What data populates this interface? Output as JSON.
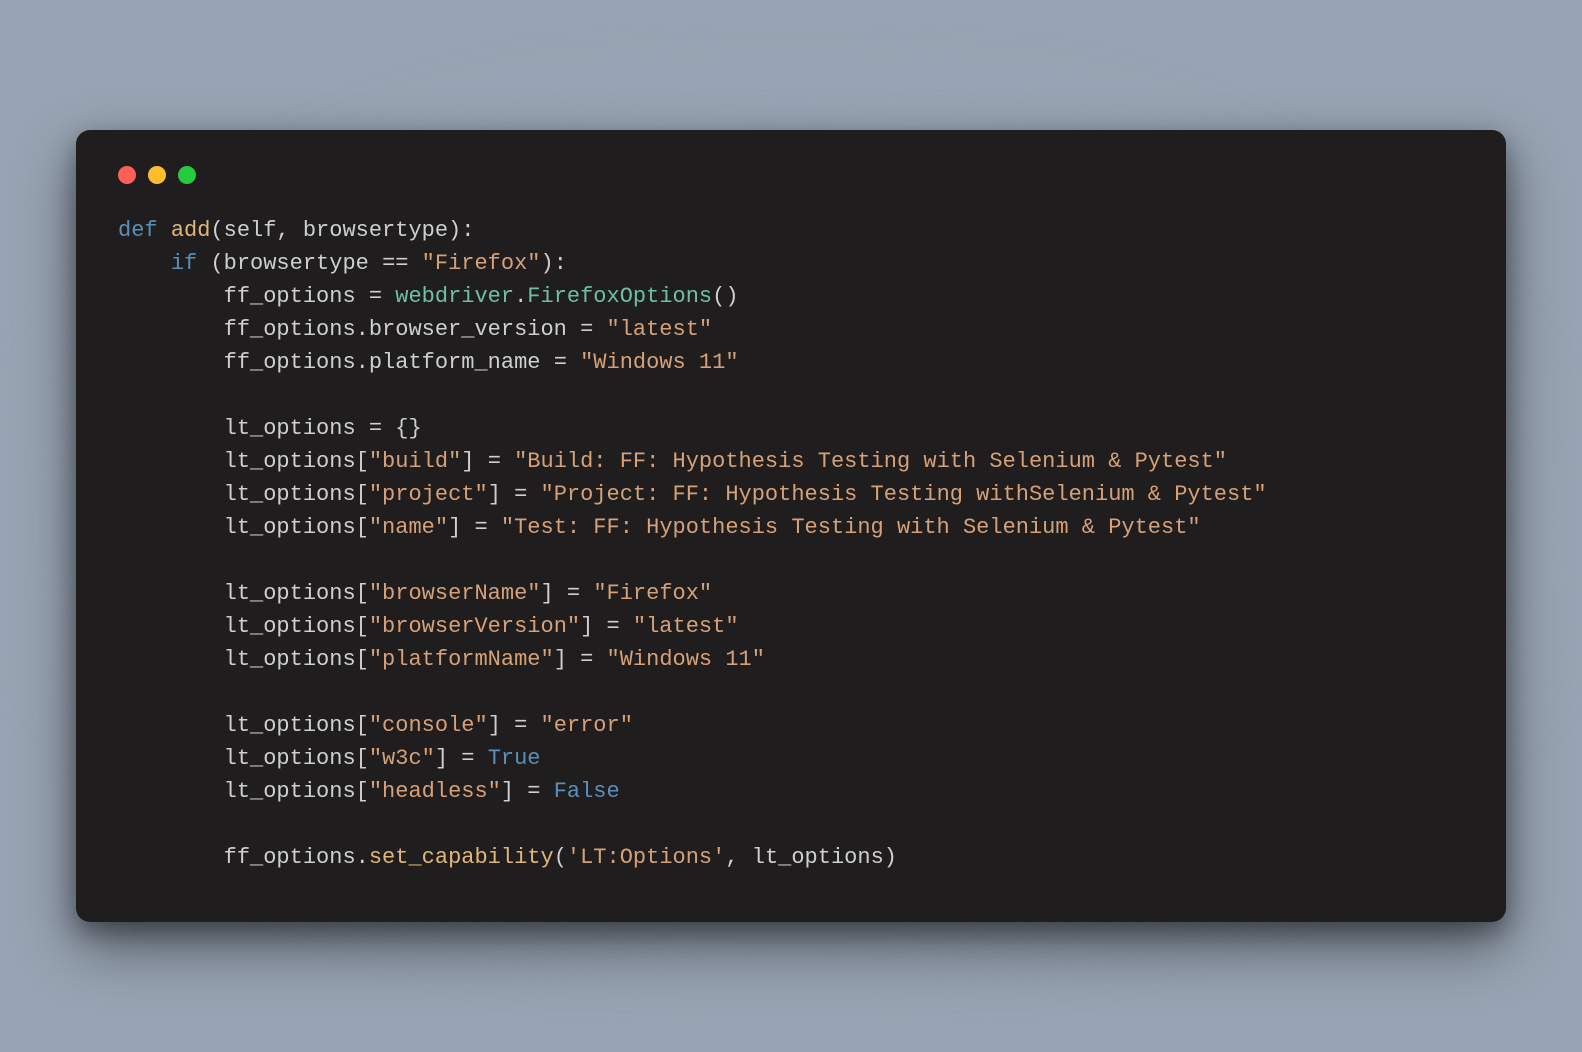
{
  "colors": {
    "traffic_red": "#ff5f56",
    "traffic_yellow": "#ffbd2e",
    "traffic_green": "#27c93f",
    "bg": "#1f1d1d"
  },
  "code": {
    "l1": {
      "kw": "def",
      "fn": "add",
      "p": "(self, browsertype):"
    },
    "l2": {
      "kw": "if",
      "p1": " (browsertype ",
      "op": "==",
      "sp": " ",
      "str": "\"Firefox\"",
      "p2": "):"
    },
    "l3": {
      "var": "ff_options",
      "op": " = ",
      "mod": "webdriver",
      "dot": ".",
      "cls": "FirefoxOptions",
      "p": "()"
    },
    "l4": {
      "pre": "ff_options.browser_version ",
      "op": "=",
      "sp": " ",
      "str": "\"latest\""
    },
    "l5": {
      "pre": "ff_options.platform_name ",
      "op": "=",
      "sp": " ",
      "str": "\"Windows 11\""
    },
    "l7": {
      "pre": "lt_options ",
      "op": "=",
      "p": " {}"
    },
    "l8": {
      "pre": "lt_options[",
      "k": "\"build\"",
      "mid": "] ",
      "op": "=",
      "sp": " ",
      "str": "\"Build: FF: Hypothesis Testing with Selenium & Pytest\""
    },
    "l9": {
      "pre": "lt_options[",
      "k": "\"project\"",
      "mid": "] ",
      "op": "=",
      "sp": " ",
      "str": "\"Project: FF: Hypothesis Testing withSelenium & Pytest\""
    },
    "l10": {
      "pre": "lt_options[",
      "k": "\"name\"",
      "mid": "] ",
      "op": "=",
      "sp": " ",
      "str": "\"Test: FF: Hypothesis Testing with Selenium & Pytest\""
    },
    "l12": {
      "pre": "lt_options[",
      "k": "\"browserName\"",
      "mid": "] ",
      "op": "=",
      "sp": " ",
      "str": "\"Firefox\""
    },
    "l13": {
      "pre": "lt_options[",
      "k": "\"browserVersion\"",
      "mid": "] ",
      "op": "=",
      "sp": " ",
      "str": "\"latest\""
    },
    "l14": {
      "pre": "lt_options[",
      "k": "\"platformName\"",
      "mid": "] ",
      "op": "=",
      "sp": " ",
      "str": "\"Windows 11\""
    },
    "l16": {
      "pre": "lt_options[",
      "k": "\"console\"",
      "mid": "] ",
      "op": "=",
      "sp": " ",
      "str": "\"error\""
    },
    "l17": {
      "pre": "lt_options[",
      "k": "\"w3c\"",
      "mid": "] ",
      "op": "=",
      "sp": " ",
      "bool": "True"
    },
    "l18": {
      "pre": "lt_options[",
      "k": "\"headless\"",
      "mid": "] ",
      "op": "=",
      "sp": " ",
      "bool": "False"
    },
    "l20": {
      "pre": "ff_options.",
      "fn": "set_capability",
      "p1": "(",
      "str": "'LT:Options'",
      "p2": ", lt_options)"
    }
  },
  "indent": {
    "i1": "    ",
    "i2": "        "
  }
}
